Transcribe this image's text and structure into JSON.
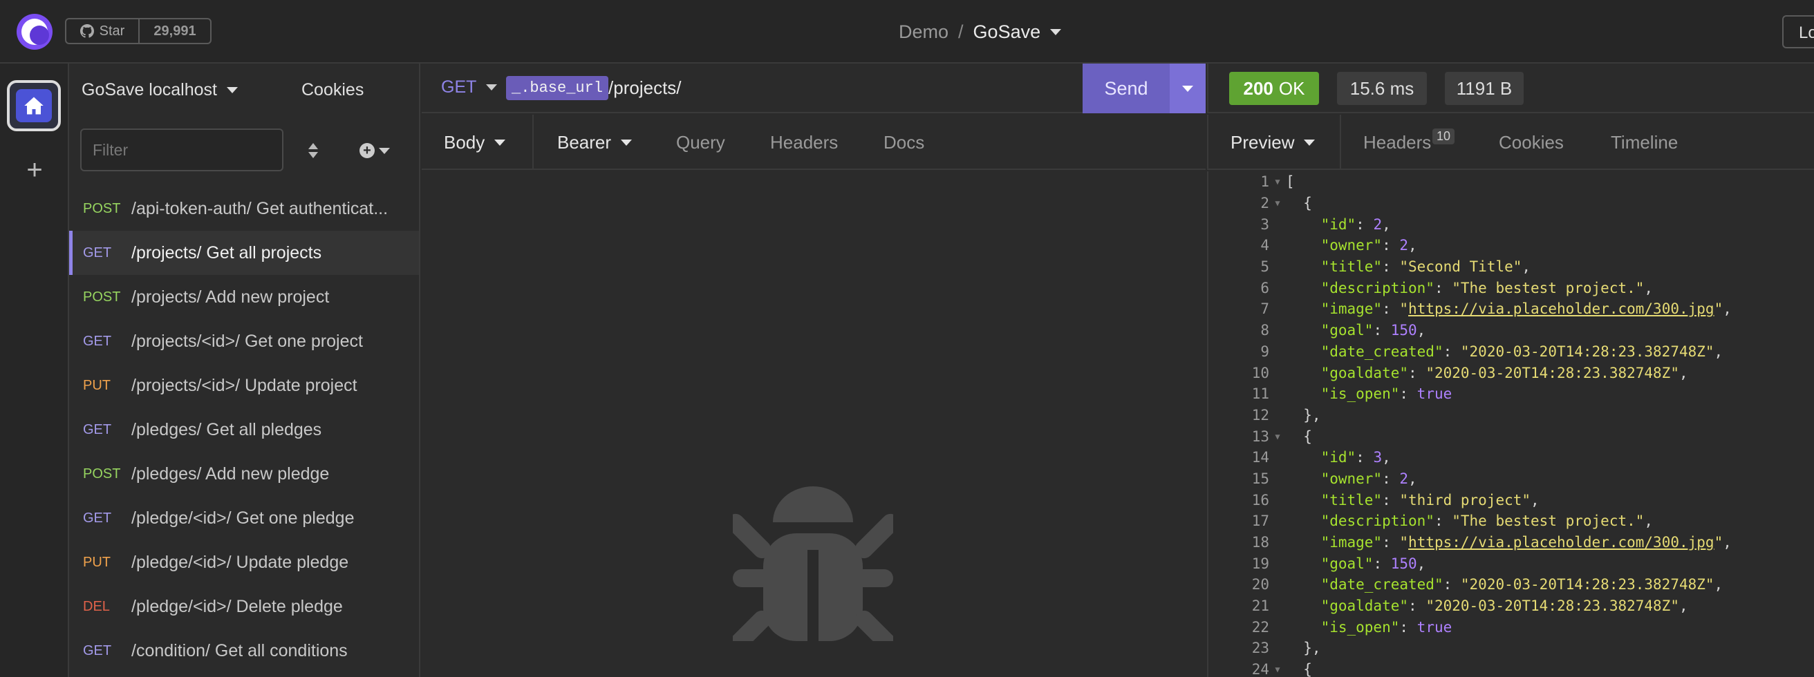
{
  "topbar": {
    "github": {
      "star_label": "Star",
      "star_count": "29,991"
    },
    "breadcrumb": {
      "workspace": "Demo",
      "separator": "/",
      "project": "GoSave"
    },
    "login_label": "Lo"
  },
  "sidebar": {
    "environment": "GoSave localhost",
    "cookies_label": "Cookies",
    "filter_placeholder": "Filter",
    "requests": [
      {
        "method": "POST",
        "method_color": "#97d560",
        "label": "/api-token-auth/ Get authenticat...",
        "active": false
      },
      {
        "method": "GET",
        "method_color": "#a39ae9",
        "label": "/projects/ Get all projects",
        "active": true
      },
      {
        "method": "POST",
        "method_color": "#97d560",
        "label": "/projects/ Add new project",
        "active": false
      },
      {
        "method": "GET",
        "method_color": "#a39ae9",
        "label": "/projects/<id>/ Get one project",
        "active": false
      },
      {
        "method": "PUT",
        "method_color": "#f0a24c",
        "label": "/projects/<id>/ Update project",
        "active": false
      },
      {
        "method": "GET",
        "method_color": "#a39ae9",
        "label": "/pledges/ Get all pledges",
        "active": false
      },
      {
        "method": "POST",
        "method_color": "#97d560",
        "label": "/pledges/ Add new pledge",
        "active": false
      },
      {
        "method": "GET",
        "method_color": "#a39ae9",
        "label": "/pledge/<id>/ Get one pledge",
        "active": false
      },
      {
        "method": "PUT",
        "method_color": "#f0a24c",
        "label": "/pledge/<id>/ Update pledge",
        "active": false
      },
      {
        "method": "DEL",
        "method_color": "#e0624a",
        "label": "/pledge/<id>/ Delete pledge",
        "active": false
      },
      {
        "method": "GET",
        "method_color": "#a39ae9",
        "label": "/condition/ Get all conditions",
        "active": false
      }
    ]
  },
  "request": {
    "method": "GET",
    "url_variable": "_.base_url",
    "url_path": "/projects/",
    "send_label": "Send",
    "tabs": {
      "body": "Body",
      "auth": "Bearer",
      "query": "Query",
      "headers": "Headers",
      "docs": "Docs"
    }
  },
  "response": {
    "status_code": "200",
    "status_text": "OK",
    "time": "15.6 ms",
    "size": "1191 B",
    "tabs": {
      "preview": "Preview",
      "headers": "Headers",
      "headers_count": "10",
      "cookies": "Cookies",
      "timeline": "Timeline"
    },
    "code_lines": [
      {
        "n": "1",
        "fold": true,
        "parts": [
          [
            "p",
            "["
          ]
        ]
      },
      {
        "n": "2",
        "fold": true,
        "parts": [
          [
            "p",
            "  {"
          ]
        ]
      },
      {
        "n": "3",
        "fold": false,
        "parts": [
          [
            "p",
            "    "
          ],
          [
            "k",
            "\"id\""
          ],
          [
            "p",
            ": "
          ],
          [
            "n",
            "2"
          ],
          [
            "p",
            ","
          ]
        ]
      },
      {
        "n": "4",
        "fold": false,
        "parts": [
          [
            "p",
            "    "
          ],
          [
            "k",
            "\"owner\""
          ],
          [
            "p",
            ": "
          ],
          [
            "n",
            "2"
          ],
          [
            "p",
            ","
          ]
        ]
      },
      {
        "n": "5",
        "fold": false,
        "parts": [
          [
            "p",
            "    "
          ],
          [
            "k",
            "\"title\""
          ],
          [
            "p",
            ": "
          ],
          [
            "s",
            "\"Second Title\""
          ],
          [
            "p",
            ","
          ]
        ]
      },
      {
        "n": "6",
        "fold": false,
        "parts": [
          [
            "p",
            "    "
          ],
          [
            "k",
            "\"description\""
          ],
          [
            "p",
            ": "
          ],
          [
            "s",
            "\"The bestest project.\""
          ],
          [
            "p",
            ","
          ]
        ]
      },
      {
        "n": "7",
        "fold": false,
        "parts": [
          [
            "p",
            "    "
          ],
          [
            "k",
            "\"image\""
          ],
          [
            "p",
            ": "
          ],
          [
            "s",
            "\""
          ],
          [
            "u",
            "https://via.placeholder.com/300.jpg"
          ],
          [
            "s",
            "\""
          ],
          [
            "p",
            ","
          ]
        ]
      },
      {
        "n": "8",
        "fold": false,
        "parts": [
          [
            "p",
            "    "
          ],
          [
            "k",
            "\"goal\""
          ],
          [
            "p",
            ": "
          ],
          [
            "n",
            "150"
          ],
          [
            "p",
            ","
          ]
        ]
      },
      {
        "n": "9",
        "fold": false,
        "parts": [
          [
            "p",
            "    "
          ],
          [
            "k",
            "\"date_created\""
          ],
          [
            "p",
            ": "
          ],
          [
            "s",
            "\"2020-03-20T14:28:23.382748Z\""
          ],
          [
            "p",
            ","
          ]
        ]
      },
      {
        "n": "10",
        "fold": false,
        "parts": [
          [
            "p",
            "    "
          ],
          [
            "k",
            "\"goaldate\""
          ],
          [
            "p",
            ": "
          ],
          [
            "s",
            "\"2020-03-20T14:28:23.382748Z\""
          ],
          [
            "p",
            ","
          ]
        ]
      },
      {
        "n": "11",
        "fold": false,
        "parts": [
          [
            "p",
            "    "
          ],
          [
            "k",
            "\"is_open\""
          ],
          [
            "p",
            ": "
          ],
          [
            "b",
            "true"
          ]
        ]
      },
      {
        "n": "12",
        "fold": false,
        "parts": [
          [
            "p",
            "  },"
          ]
        ]
      },
      {
        "n": "13",
        "fold": true,
        "parts": [
          [
            "p",
            "  {"
          ]
        ]
      },
      {
        "n": "14",
        "fold": false,
        "parts": [
          [
            "p",
            "    "
          ],
          [
            "k",
            "\"id\""
          ],
          [
            "p",
            ": "
          ],
          [
            "n",
            "3"
          ],
          [
            "p",
            ","
          ]
        ]
      },
      {
        "n": "15",
        "fold": false,
        "parts": [
          [
            "p",
            "    "
          ],
          [
            "k",
            "\"owner\""
          ],
          [
            "p",
            ": "
          ],
          [
            "n",
            "2"
          ],
          [
            "p",
            ","
          ]
        ]
      },
      {
        "n": "16",
        "fold": false,
        "parts": [
          [
            "p",
            "    "
          ],
          [
            "k",
            "\"title\""
          ],
          [
            "p",
            ": "
          ],
          [
            "s",
            "\"third project\""
          ],
          [
            "p",
            ","
          ]
        ]
      },
      {
        "n": "17",
        "fold": false,
        "parts": [
          [
            "p",
            "    "
          ],
          [
            "k",
            "\"description\""
          ],
          [
            "p",
            ": "
          ],
          [
            "s",
            "\"The bestest project.\""
          ],
          [
            "p",
            ","
          ]
        ]
      },
      {
        "n": "18",
        "fold": false,
        "parts": [
          [
            "p",
            "    "
          ],
          [
            "k",
            "\"image\""
          ],
          [
            "p",
            ": "
          ],
          [
            "s",
            "\""
          ],
          [
            "u",
            "https://via.placeholder.com/300.jpg"
          ],
          [
            "s",
            "\""
          ],
          [
            "p",
            ","
          ]
        ]
      },
      {
        "n": "19",
        "fold": false,
        "parts": [
          [
            "p",
            "    "
          ],
          [
            "k",
            "\"goal\""
          ],
          [
            "p",
            ": "
          ],
          [
            "n",
            "150"
          ],
          [
            "p",
            ","
          ]
        ]
      },
      {
        "n": "20",
        "fold": false,
        "parts": [
          [
            "p",
            "    "
          ],
          [
            "k",
            "\"date_created\""
          ],
          [
            "p",
            ": "
          ],
          [
            "s",
            "\"2020-03-20T14:28:23.382748Z\""
          ],
          [
            "p",
            ","
          ]
        ]
      },
      {
        "n": "21",
        "fold": false,
        "parts": [
          [
            "p",
            "    "
          ],
          [
            "k",
            "\"goaldate\""
          ],
          [
            "p",
            ": "
          ],
          [
            "s",
            "\"2020-03-20T14:28:23.382748Z\""
          ],
          [
            "p",
            ","
          ]
        ]
      },
      {
        "n": "22",
        "fold": false,
        "parts": [
          [
            "p",
            "    "
          ],
          [
            "k",
            "\"is_open\""
          ],
          [
            "p",
            ": "
          ],
          [
            "b",
            "true"
          ]
        ]
      },
      {
        "n": "23",
        "fold": false,
        "parts": [
          [
            "p",
            "  },"
          ]
        ]
      },
      {
        "n": "24",
        "fold": true,
        "parts": [
          [
            "p",
            "  {"
          ]
        ]
      }
    ]
  },
  "colors": {
    "accent": "#7b70d6",
    "status_ok": "#5fa332",
    "background": "#2b2b2b"
  },
  "icons": {
    "logo": "insomnia-logo-icon",
    "github": "github-icon",
    "home": "home-icon",
    "bug": "bug-icon"
  }
}
